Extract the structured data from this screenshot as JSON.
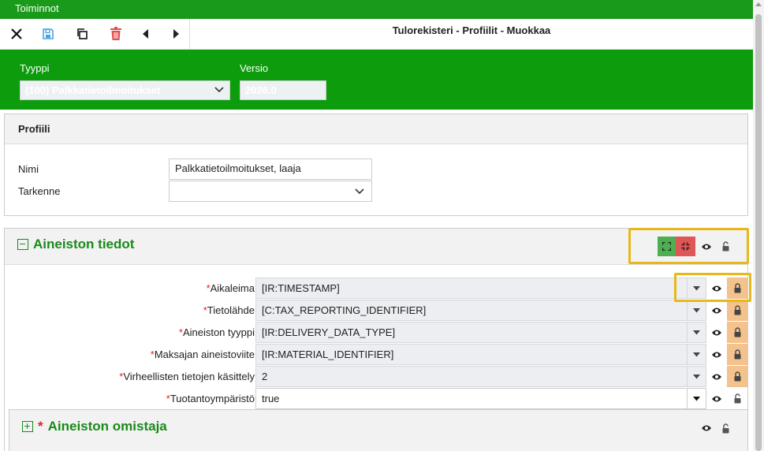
{
  "app": {
    "menu_title": "Toiminnot",
    "page_title": "Tulorekisteri - Profiilit - Muokkaa"
  },
  "toolbar": {
    "icons": [
      "close-icon",
      "save-icon",
      "copy-icon",
      "delete-icon",
      "previous-icon",
      "next-icon"
    ],
    "colors": {
      "save": "#4aa3df",
      "delete": "#e05050"
    }
  },
  "header": {
    "type_label": "Tyyppi",
    "type_value": "(100) Palkkatietoilmoitukset",
    "version_label": "Versio",
    "version_value": "2026.0",
    "color": "#0c9c0c"
  },
  "profile": {
    "title": "Profiili",
    "name_label": "Nimi",
    "name_value": "Palkkatietoilmoitukset, laaja",
    "spec_label": "Tarkenne",
    "spec_value": ""
  },
  "dataset": {
    "title": "Aineiston tiedot",
    "rows": [
      {
        "label": "Aikaleima",
        "value": "[IR:TIMESTAMP]",
        "locked": true
      },
      {
        "label": "Tietolähde",
        "value": "[C:TAX_REPORTING_IDENTIFIER]",
        "locked": true
      },
      {
        "label": "Aineiston tyyppi",
        "value": "[IR:DELIVERY_DATA_TYPE]",
        "locked": true
      },
      {
        "label": "Maksajan aineistoviite",
        "value": "[IR:MATERIAL_IDENTIFIER]",
        "locked": true
      },
      {
        "label": "Virheellisten tietojen käsittely",
        "value": "2",
        "locked": true
      },
      {
        "label": "Tuotantoympäristö",
        "value": "true",
        "locked": false
      }
    ],
    "required_mark": "*"
  },
  "owner": {
    "title": "Aineiston omistaja",
    "required_mark": "*"
  }
}
